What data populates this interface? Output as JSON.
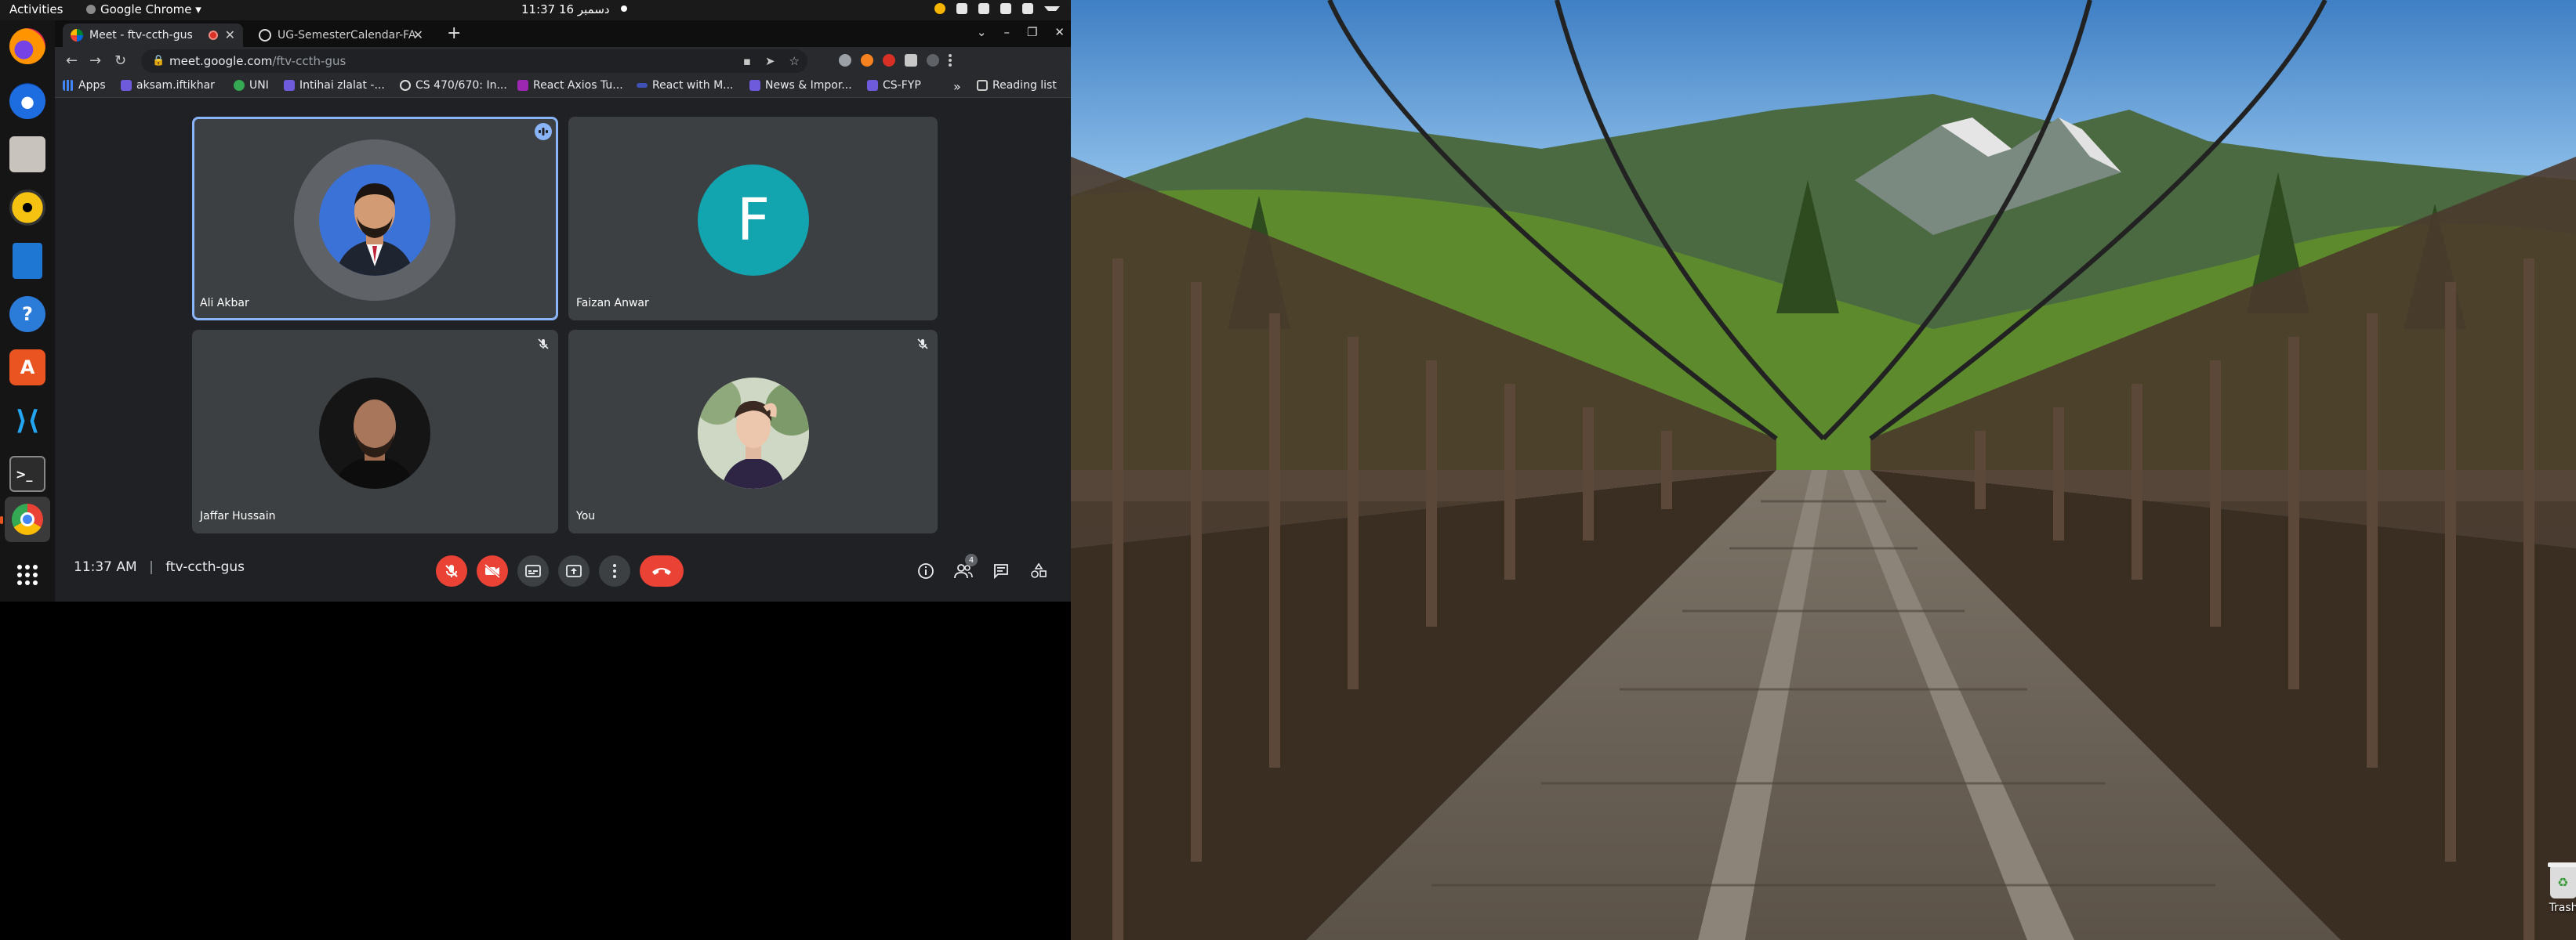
{
  "topbar": {
    "activities": "Activities",
    "app_menu": "Google Chrome ▾",
    "clock": "11:37  16 دسمبر"
  },
  "dock": {
    "items": [
      "firefox-icon",
      "thunderbird-icon",
      "files-icon",
      "rhythmbox-icon",
      "writer-icon",
      "help-icon",
      "software-icon",
      "vscode-icon",
      "terminal-icon",
      "chrome-icon",
      "apps-grid-icon"
    ]
  },
  "browser": {
    "tabs": [
      {
        "title": "Meet - ftv-ccth-gus",
        "active": true
      },
      {
        "title": "UG-SemesterCalendar-FA",
        "active": false
      }
    ],
    "url_host": "meet.google.com",
    "url_path": "/ftv-ccth-gus",
    "bookmarks": [
      "Apps",
      "aksam.iftikhar",
      "UNI",
      "Intihai zlalat -...",
      "CS 470/670: In...",
      "React Axios Tu...",
      "React with M...",
      "News & Impor...",
      "CS-FYP"
    ],
    "bookmarks_more": "»",
    "reading_list": "Reading list"
  },
  "meet": {
    "participants": [
      {
        "name": "Ali Akbar",
        "initial": "",
        "speaking": true,
        "muted": false
      },
      {
        "name": "Faizan Anwar",
        "initial": "F",
        "speaking": false,
        "muted": false
      },
      {
        "name": "Jaffar Hussain",
        "initial": "",
        "speaking": false,
        "muted": true
      },
      {
        "name": "You",
        "initial": "",
        "speaking": false,
        "muted": true
      }
    ],
    "time": "11:37 AM",
    "separator": "|",
    "meeting_code": "ftv-ccth-gus",
    "people_count": "4"
  },
  "desktop": {
    "trash_label": "Trash"
  },
  "colors": {
    "accent_blue": "#8ab4f8",
    "meet_red": "#ea4335",
    "tile_bg": "#3c4043",
    "avatar_teal": "#12a4af"
  }
}
